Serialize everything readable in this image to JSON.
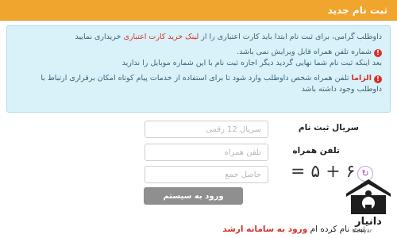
{
  "header": {
    "title": "ثبت نام جدید"
  },
  "notice": {
    "intro_before": "داوطلب گرامی، برای ثبت نام ابتدا باید کارت اعتباری را از ",
    "intro_link": "لینک خرید کارت اعتباری",
    "intro_after": " خریداری نمایید",
    "warning1": "شماره تلفن همراه قابل ویرایش نمی باشد.",
    "warning1_cont": "بعد اینکه ثبت نام شما نهایی گردید دیگر اجازه ثبت نام با این شماره موبایل را ندارید",
    "warning2_bold": "الزاما",
    "warning2": " تلفن همراه شخص داوطلب وارد شود تا برای استفاده از خدمات پیام کوتاه امکان برقراری ارتباط با داوطلب وجود داشته باشد"
  },
  "form": {
    "serial_label": "سریال ثبت نام",
    "serial_placeholder": "سریال 12 رقمی",
    "phone_label": "تلفن همراه",
    "phone_placeholder": "تلفن همراه",
    "sum_placeholder": "حاصل جمع",
    "captcha_text": "= ۵ + ۶",
    "submit_label": "ورود به سیستم"
  },
  "footer": {
    "text_before": "ثبت نام کرده ام ",
    "link": "ورود به سامانه ارشد"
  },
  "logo": {
    "caption": "دانیار",
    "sub": "daniyar"
  },
  "icons": {
    "refresh": "refresh-icon",
    "alert": "alert-icon",
    "logo": "house-logo"
  },
  "colors": {
    "header": "#f0a52e",
    "notice_bg": "#d9f1f8",
    "link_red": "#d7302b",
    "button": "#8f8f8f"
  }
}
